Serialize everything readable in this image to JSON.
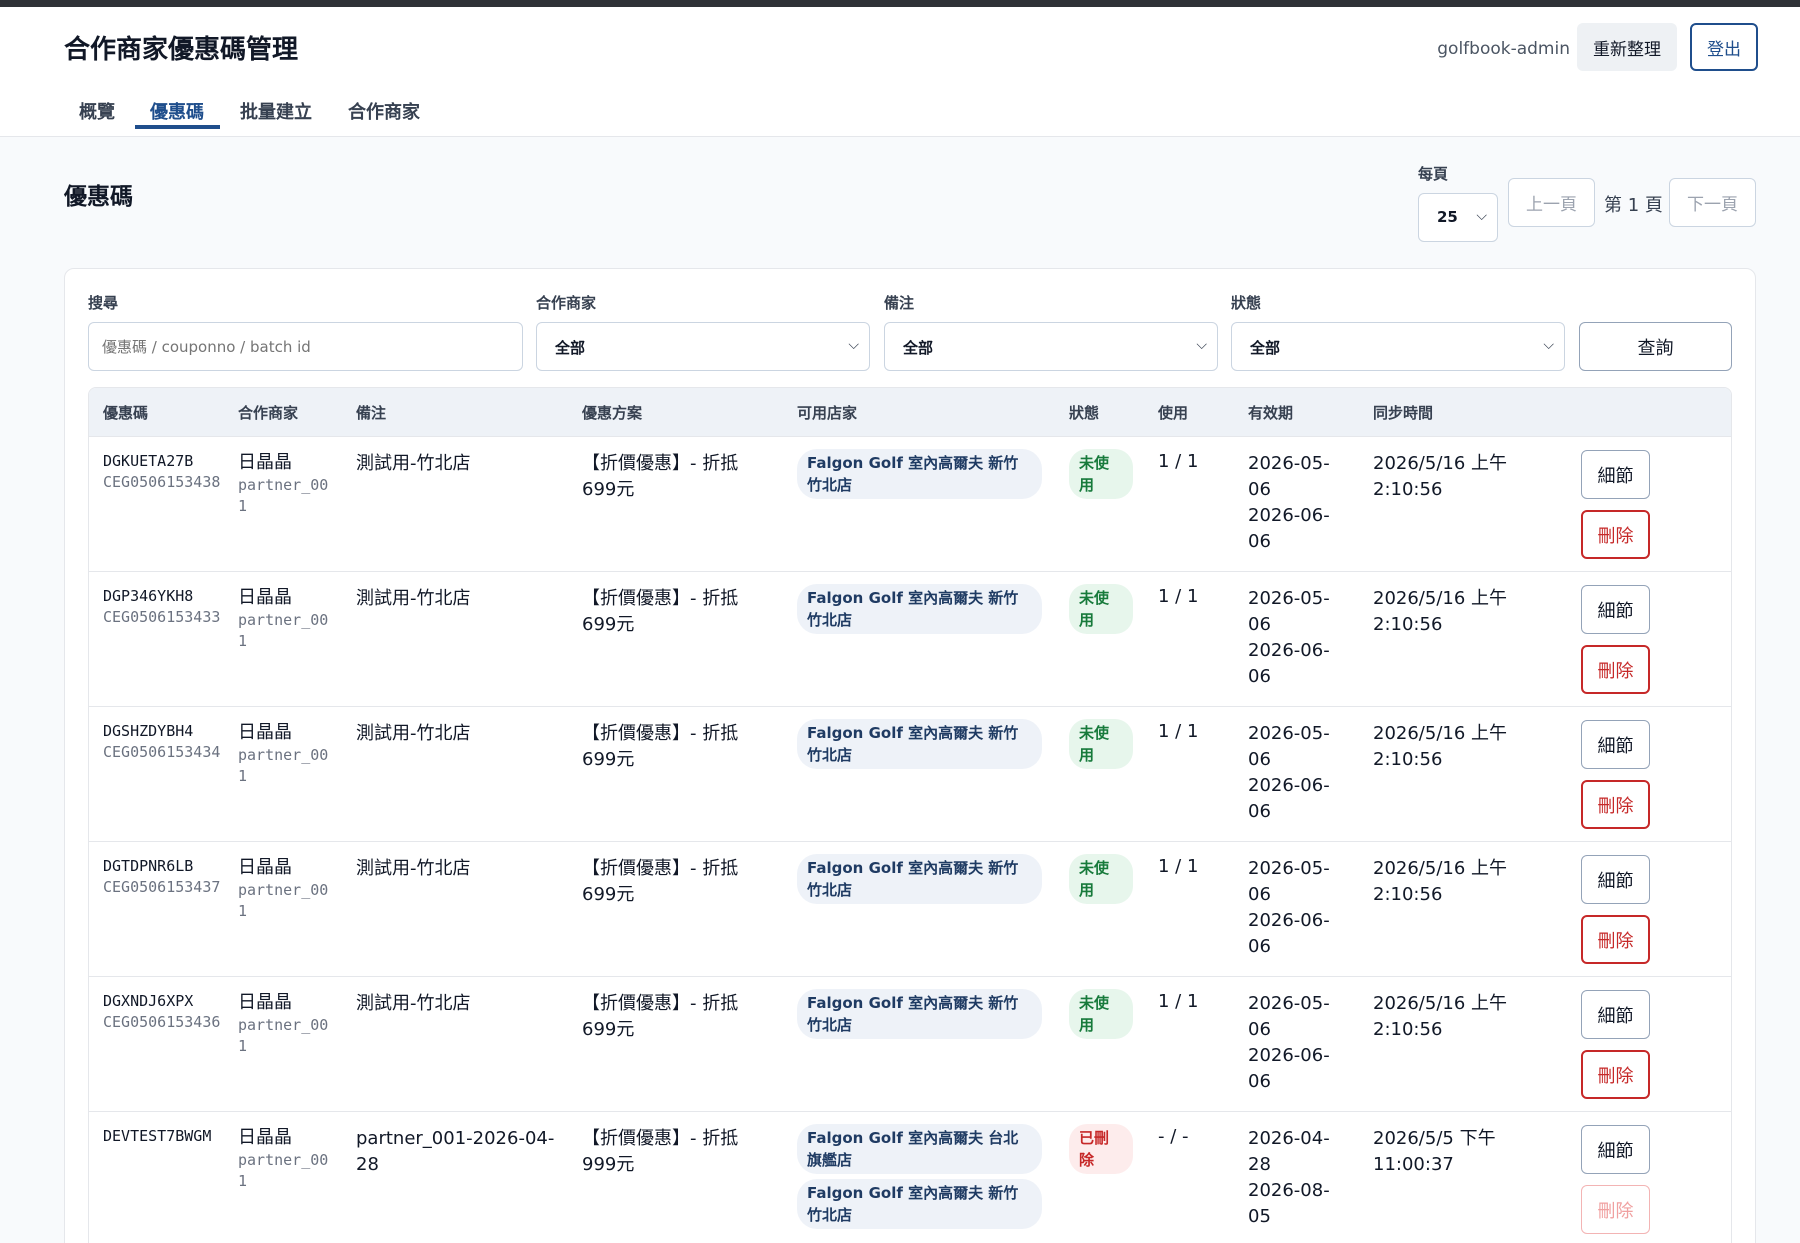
{
  "header": {
    "title": "合作商家優惠碼管理",
    "user": "golfbook-admin",
    "refresh_label": "重新整理",
    "logout_label": "登出"
  },
  "tabs": [
    {
      "label": "概覽",
      "active": false
    },
    {
      "label": "優惠碼",
      "active": true
    },
    {
      "label": "批量建立",
      "active": false
    },
    {
      "label": "合作商家",
      "active": false
    }
  ],
  "section": {
    "title": "優惠碼",
    "per_page_label": "每頁",
    "per_page_value": "25",
    "prev_label": "上一頁",
    "page_indicator": "第 1 頁",
    "next_label": "下一頁"
  },
  "filters": {
    "search_label": "搜尋",
    "search_placeholder": "優惠碼 / couponno / batch id",
    "partner_label": "合作商家",
    "partner_value": "全部",
    "note_label": "備注",
    "note_value": "全部",
    "status_label": "狀態",
    "status_value": "全部",
    "query_label": "查詢"
  },
  "table": {
    "columns": [
      "優惠碼",
      "合作商家",
      "備注",
      "優惠方案",
      "可用店家",
      "狀態",
      "使用",
      "有效期",
      "同步時間"
    ],
    "detail_label": "細節",
    "delete_label": "刪除",
    "rows": [
      {
        "code": "DGKUETA27B",
        "couponno": "CEG0506153438",
        "partner": "日晶晶",
        "partner_id": "partner_001",
        "note": "測試用-竹北店",
        "plan": "【折價優惠】- 折抵699元",
        "stores": [
          "Falgon Golf 室內高爾夫 新竹竹北店"
        ],
        "status": "未使用",
        "status_type": "unused",
        "usage": "1 / 1",
        "valid_from": "2026-05-06",
        "valid_to": "2026-06-06",
        "sync": "2026/5/16 上午2:10:56"
      },
      {
        "code": "DGP346YKH8",
        "couponno": "CEG0506153433",
        "partner": "日晶晶",
        "partner_id": "partner_001",
        "note": "測試用-竹北店",
        "plan": "【折價優惠】- 折抵699元",
        "stores": [
          "Falgon Golf 室內高爾夫 新竹竹北店"
        ],
        "status": "未使用",
        "status_type": "unused",
        "usage": "1 / 1",
        "valid_from": "2026-05-06",
        "valid_to": "2026-06-06",
        "sync": "2026/5/16 上午2:10:56"
      },
      {
        "code": "DGSHZDYBH4",
        "couponno": "CEG0506153434",
        "partner": "日晶晶",
        "partner_id": "partner_001",
        "note": "測試用-竹北店",
        "plan": "【折價優惠】- 折抵699元",
        "stores": [
          "Falgon Golf 室內高爾夫 新竹竹北店"
        ],
        "status": "未使用",
        "status_type": "unused",
        "usage": "1 / 1",
        "valid_from": "2026-05-06",
        "valid_to": "2026-06-06",
        "sync": "2026/5/16 上午2:10:56"
      },
      {
        "code": "DGTDPNR6LB",
        "couponno": "CEG0506153437",
        "partner": "日晶晶",
        "partner_id": "partner_001",
        "note": "測試用-竹北店",
        "plan": "【折價優惠】- 折抵699元",
        "stores": [
          "Falgon Golf 室內高爾夫 新竹竹北店"
        ],
        "status": "未使用",
        "status_type": "unused",
        "usage": "1 / 1",
        "valid_from": "2026-05-06",
        "valid_to": "2026-06-06",
        "sync": "2026/5/16 上午2:10:56"
      },
      {
        "code": "DGXNDJ6XPX",
        "couponno": "CEG0506153436",
        "partner": "日晶晶",
        "partner_id": "partner_001",
        "note": "測試用-竹北店",
        "plan": "【折價優惠】- 折抵699元",
        "stores": [
          "Falgon Golf 室內高爾夫 新竹竹北店"
        ],
        "status": "未使用",
        "status_type": "unused",
        "usage": "1 / 1",
        "valid_from": "2026-05-06",
        "valid_to": "2026-06-06",
        "sync": "2026/5/16 上午2:10:56"
      },
      {
        "code": "DEVTEST7BWGM",
        "couponno": "",
        "partner": "日晶晶",
        "partner_id": "partner_001",
        "note": "partner_001-2026-04-28",
        "plan": "【折價優惠】- 折抵999元",
        "stores": [
          "Falgon Golf 室內高爾夫 台北旗艦店",
          "Falgon Golf 室內高爾夫 新竹竹北店"
        ],
        "status": "已刪除",
        "status_type": "deleted",
        "usage": "- / -",
        "valid_from": "2026-04-28",
        "valid_to": "2026-08-05",
        "sync": "2026/5/5 下午11:00:37"
      }
    ]
  }
}
